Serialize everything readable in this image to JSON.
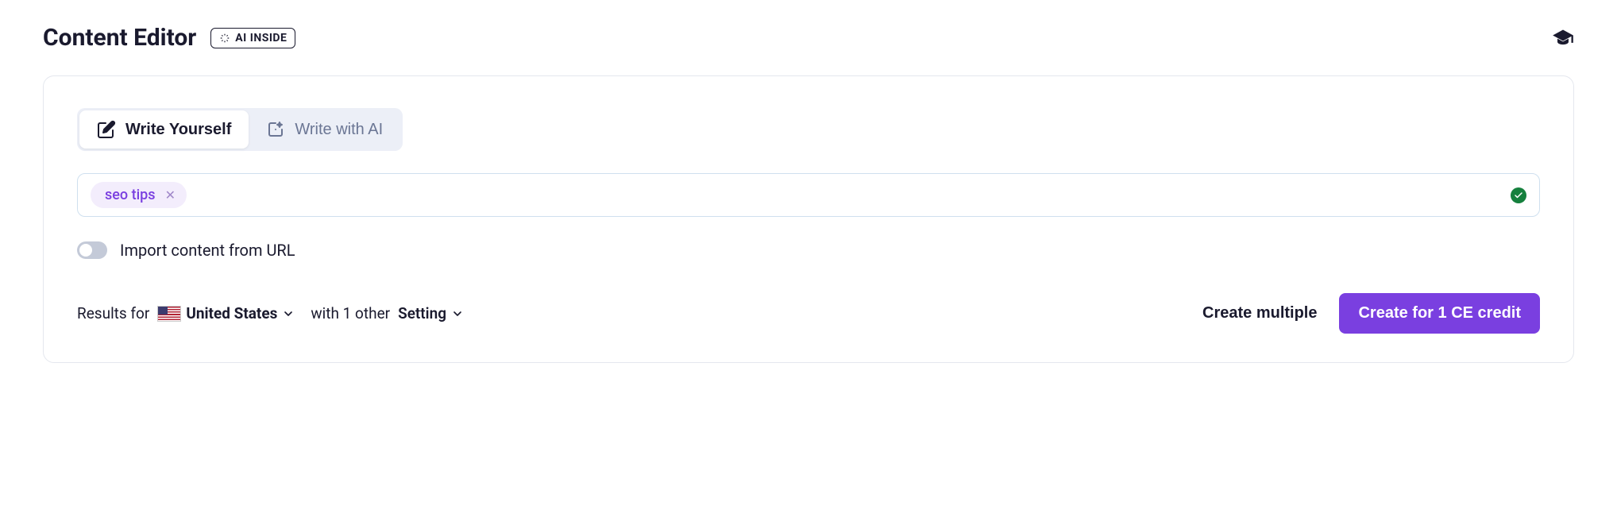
{
  "header": {
    "title": "Content Editor",
    "badge": "AI INSIDE"
  },
  "tabs": {
    "write_yourself": "Write Yourself",
    "write_with_ai": "Write with AI"
  },
  "input": {
    "tag": "seo tips"
  },
  "toggle": {
    "label": "Import content from URL"
  },
  "footer": {
    "results_prefix": "Results for",
    "country": "United States",
    "with_prefix": "with 1 other",
    "setting_label": "Setting",
    "create_multiple": "Create multiple",
    "create_cta": "Create for 1 CE credit"
  }
}
